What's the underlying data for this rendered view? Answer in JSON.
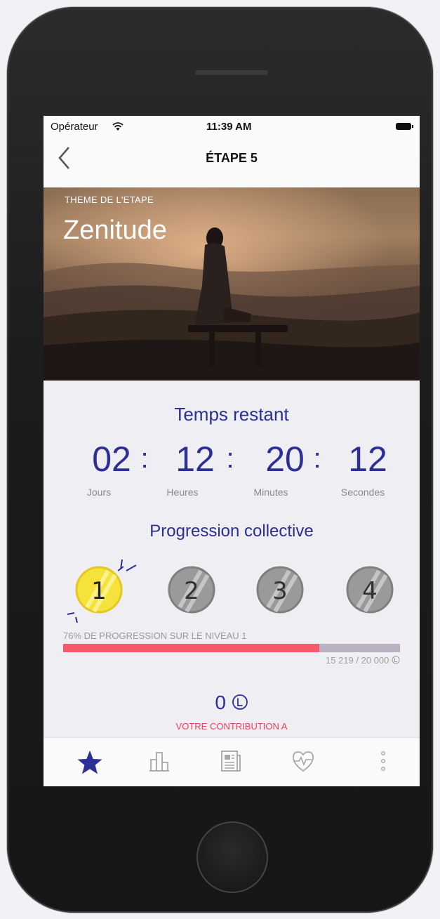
{
  "status": {
    "carrier": "Opérateur",
    "time": "11:39 AM"
  },
  "nav": {
    "title": "ÉTAPE 5",
    "back_icon": "chevron-left-icon"
  },
  "hero": {
    "label": "THEME DE L'ETAPE",
    "title": "Zenitude"
  },
  "countdown": {
    "title": "Temps restant",
    "items": [
      {
        "value": "02",
        "unit": "Jours"
      },
      {
        "value": "12",
        "unit": "Heures"
      },
      {
        "value": "20",
        "unit": "Minutes"
      },
      {
        "value": "12",
        "unit": "Secondes"
      }
    ],
    "separator": ":"
  },
  "progress": {
    "title": "Progression collective",
    "levels": [
      {
        "number": "1",
        "active": true
      },
      {
        "number": "2",
        "active": false
      },
      {
        "number": "3",
        "active": false
      },
      {
        "number": "4",
        "active": false
      }
    ],
    "label": "76% DE PROGRESSION SUR LE NIVEAU 1",
    "percent": 76,
    "count": "15 219 / 20 000"
  },
  "contribution": {
    "value": "0",
    "label": "VOTRE CONTRIBUTION A"
  },
  "tabbar": {
    "tabs": [
      {
        "icon": "star-icon",
        "active": true
      },
      {
        "icon": "bar-chart-icon",
        "active": false
      },
      {
        "icon": "newspaper-icon",
        "active": false
      },
      {
        "icon": "heart-pulse-icon",
        "active": false
      },
      {
        "icon": "more-vertical-icon",
        "active": false
      }
    ]
  },
  "colors": {
    "accent": "#2b2f96",
    "progress": "#f45a6a",
    "contribution": "#e8405a",
    "coin_active": "#f5e23a"
  }
}
